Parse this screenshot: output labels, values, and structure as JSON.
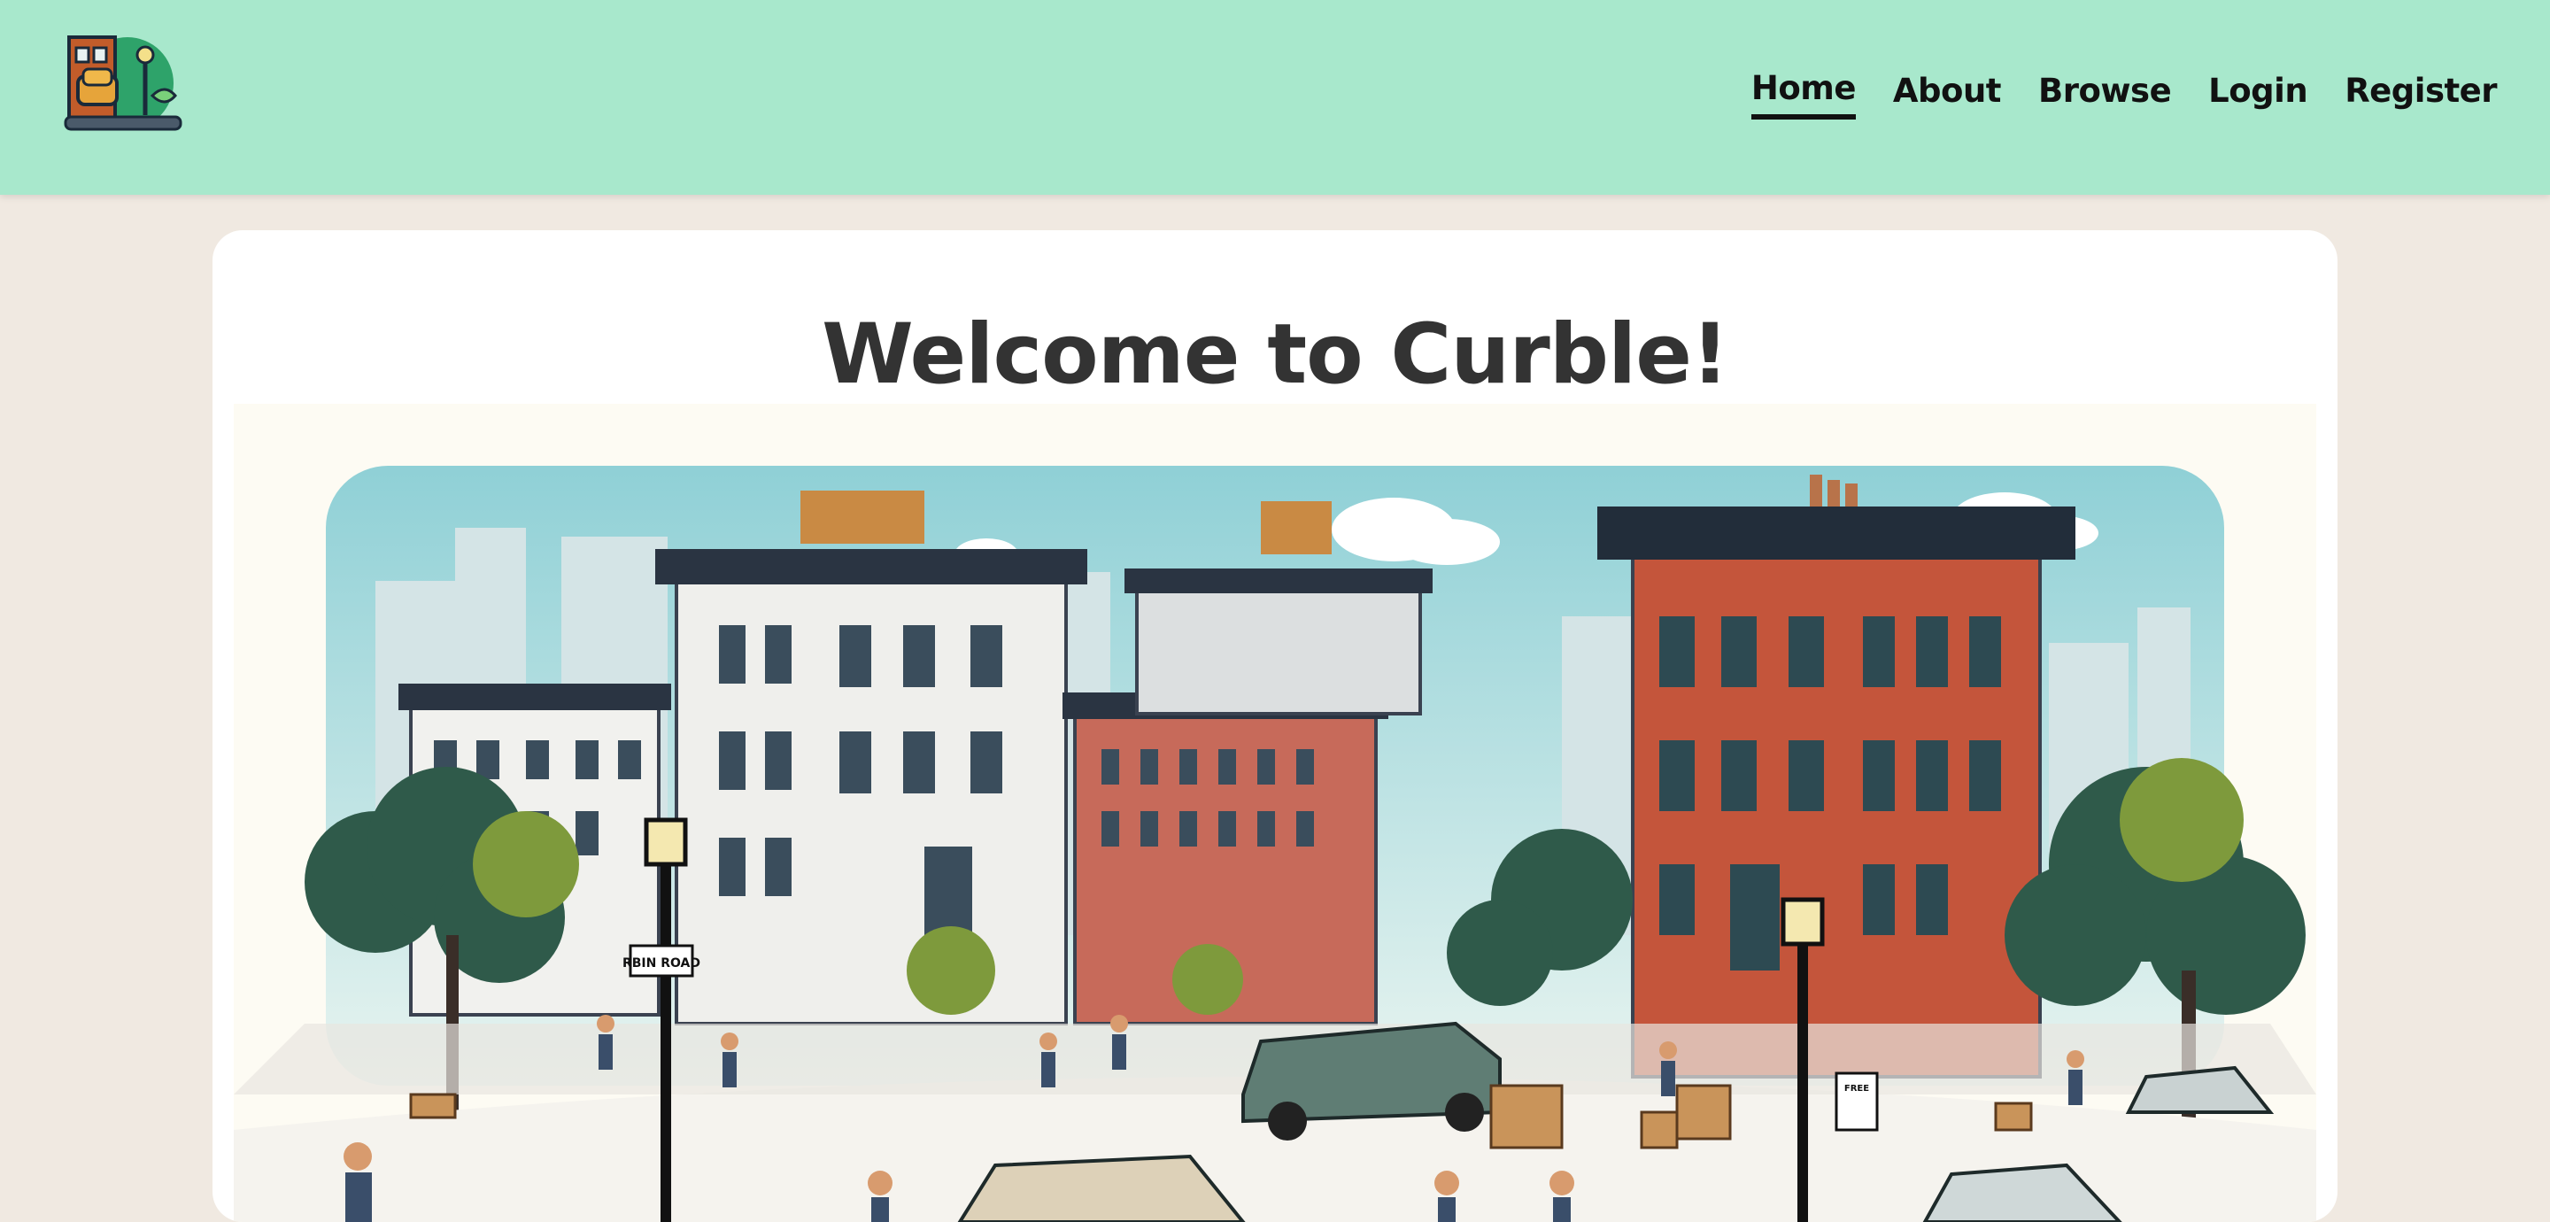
{
  "nav": {
    "items": [
      {
        "label": "Home",
        "active": true
      },
      {
        "label": "About",
        "active": false
      },
      {
        "label": "Browse",
        "active": false
      },
      {
        "label": "Login",
        "active": false
      },
      {
        "label": "Register",
        "active": false
      }
    ]
  },
  "main": {
    "title": "Welcome to Curble!"
  },
  "hero": {
    "sign_street": "RBIN ROAD",
    "sign_price": "FREE"
  },
  "colors": {
    "header_bg": "#a8e8cc",
    "page_bg": "#f0e9e1",
    "card_bg": "#ffffff",
    "title_text": "#333333",
    "brick": "#c4553b",
    "sky": "#a9dbe0"
  },
  "icons": [
    "curble-logo-icon",
    "street-lamp-icon"
  ]
}
